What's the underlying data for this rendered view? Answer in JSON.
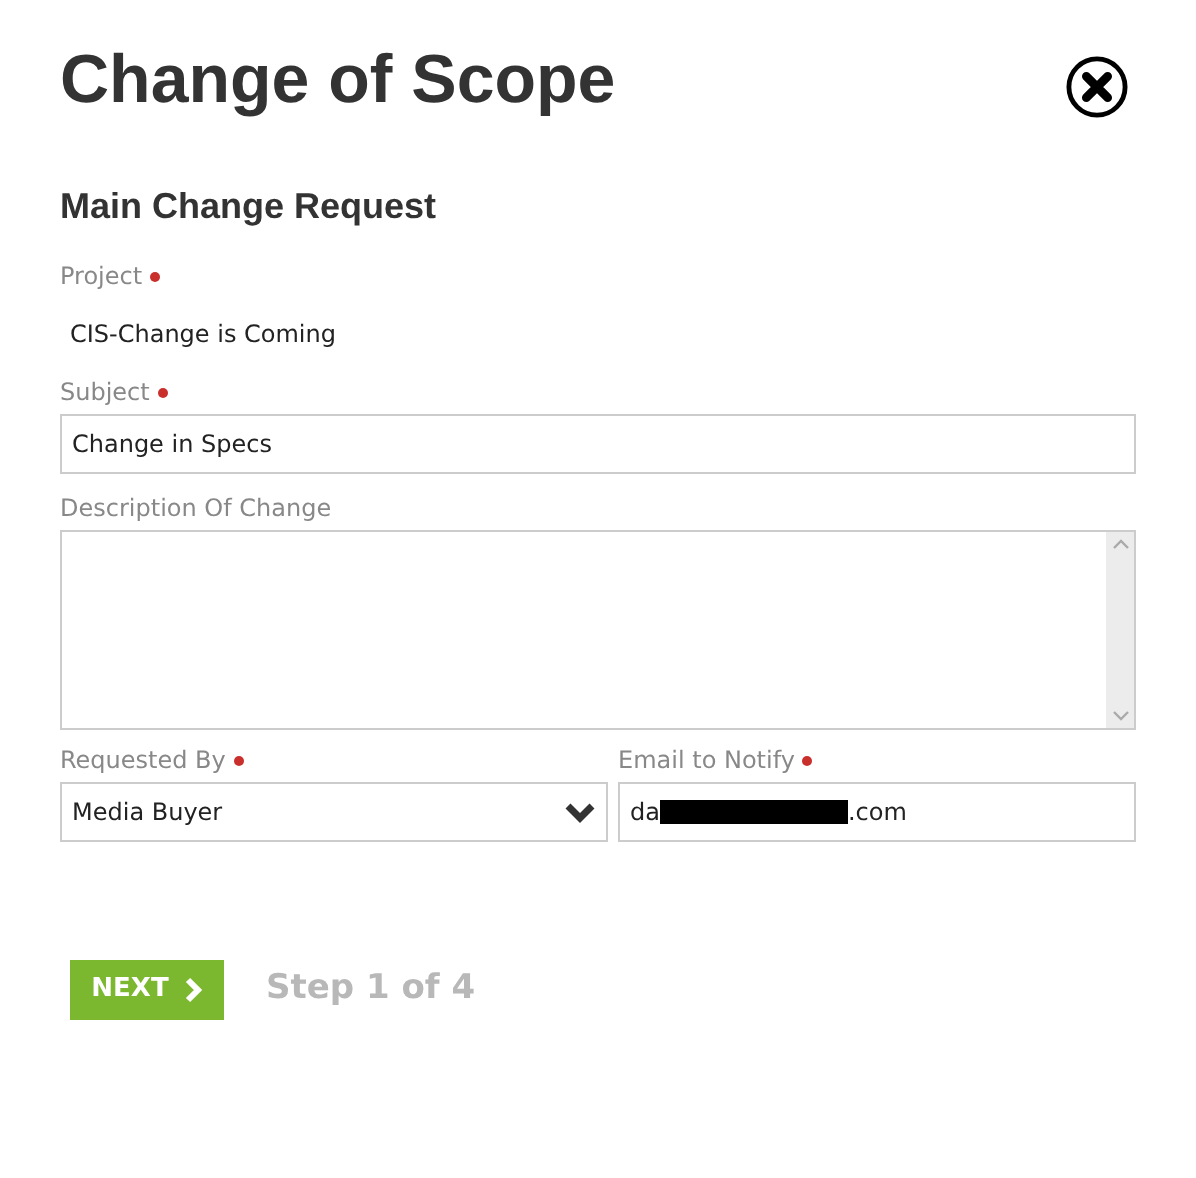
{
  "title": "Change of Scope",
  "section_title": "Main Change Request",
  "project": {
    "label": "Project",
    "required": true,
    "value": "CIS-Change is Coming"
  },
  "subject": {
    "label": "Subject",
    "required": true,
    "value": "Change in Specs"
  },
  "description": {
    "label": "Description Of Change",
    "required": false
  },
  "requested_by": {
    "label": "Requested By",
    "required": true,
    "value": "Media Buyer"
  },
  "email": {
    "label": "Email to Notify",
    "required": true,
    "value_start": "da",
    "value_end": ".com",
    "redacted": true
  },
  "next_button": {
    "label": "NEXT"
  },
  "step": "Step 1 of 4"
}
